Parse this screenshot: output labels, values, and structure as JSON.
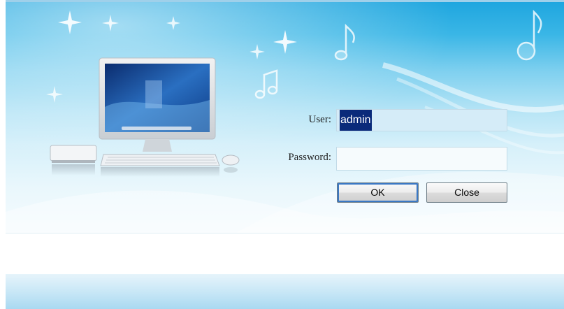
{
  "login": {
    "user_label": "User:",
    "user_value": "admin",
    "password_label": "Password:",
    "password_value": "",
    "ok_label": "OK",
    "close_label": "Close"
  },
  "colors": {
    "banner_top": "#1fa6df",
    "banner_bottom": "#f5fbfe",
    "input_bg": "#d5ecf8",
    "selection": "#0a2a7a",
    "focus_ring": "#3a78c4"
  },
  "icons": [
    "computer-monitor-icon",
    "music-note-icon",
    "sparkle-icon",
    "keyboard-icon",
    "mouse-icon",
    "mini-pc-icon"
  ]
}
